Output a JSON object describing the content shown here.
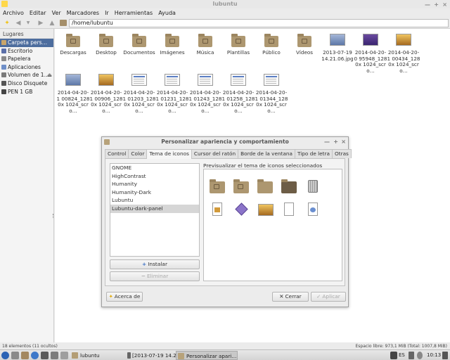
{
  "window": {
    "title": "lubuntu",
    "controls": [
      "—",
      "+",
      "×"
    ]
  },
  "menu": [
    "Archivo",
    "Editar",
    "Ver",
    "Marcadores",
    "Ir",
    "Herramientas",
    "Ayuda"
  ],
  "location": {
    "path": "/home/lubuntu"
  },
  "sidebar": {
    "header": "Lugares",
    "items": [
      {
        "label": "Carpeta pers…",
        "icon": "home-icon",
        "color": "#c9a66b"
      },
      {
        "label": "Escritorio",
        "icon": "desktop-icon",
        "color": "#5b6fa8"
      },
      {
        "label": "Papelera",
        "icon": "trash-icon",
        "color": "#8a8a8a"
      },
      {
        "label": "Aplicaciones",
        "icon": "applications-icon",
        "color": "#6f8fc8"
      },
      {
        "label": "Volumen de 1…",
        "icon": "drive-icon",
        "color": "#7a7a7a"
      },
      {
        "label": "Disco Disquete",
        "icon": "floppy-icon",
        "color": "#555555"
      },
      {
        "label": "PEN 1 GB",
        "icon": "usb-icon",
        "color": "#444444"
      }
    ]
  },
  "files": [
    {
      "name": "Descargas",
      "kind": "folder"
    },
    {
      "name": "Desktop",
      "kind": "folder"
    },
    {
      "name": "Documentos",
      "kind": "folder"
    },
    {
      "name": "Imágenes",
      "kind": "folder"
    },
    {
      "name": "Música",
      "kind": "folder"
    },
    {
      "name": "Plantillas",
      "kind": "folder"
    },
    {
      "name": "Público",
      "kind": "folder"
    },
    {
      "name": "Vídeos",
      "kind": "folder"
    },
    {
      "name": "2013-07-19 14.21.06.jpg",
      "kind": "blue"
    },
    {
      "name": "2014-04-20-0 95948_1280x 1024_scro…",
      "kind": "purple"
    },
    {
      "name": "2014-04-20-1 00434_1280x 1024_scro…",
      "kind": "tree"
    },
    {
      "name": "2014-04-20-1 00824_1280x 1024_scro…",
      "kind": "blue"
    },
    {
      "name": "2014-04-20-1 00906_1280x 1024_scro…",
      "kind": "tree"
    },
    {
      "name": "2014-04-20-1 01203_1280x 1024_scro…",
      "kind": "white"
    },
    {
      "name": "2014-04-20-1 01231_1280x 1024_scro…",
      "kind": "white"
    },
    {
      "name": "2014-04-20-1 01243_1280x 1024_scro…",
      "kind": "white"
    },
    {
      "name": "2014-04-20-1 01258_1280x 1024_scro…",
      "kind": "white"
    },
    {
      "name": "2014-04-20-1 01344_1280x 1024_scro…",
      "kind": "white"
    }
  ],
  "dialog": {
    "title": "Personalizar apariencia y comportamiento",
    "controls": [
      "—",
      "+",
      "×"
    ],
    "tabs": [
      "Control",
      "Color",
      "Tema de iconos",
      "Cursor del ratón",
      "Borde de la ventana",
      "Tipo de letra",
      "Otras"
    ],
    "themes": [
      "GNOME",
      "HighContrast",
      "Humanity",
      "Humanity-Dark",
      "Lubuntu",
      "Lubuntu-dark-panel"
    ],
    "install_label": "Instalar",
    "remove_label": "Eliminar",
    "preview_label": "Previsualizar el tema de iconos seleccionados",
    "about_label": "Acerca de",
    "close_label": "Cerrar",
    "apply_label": "Aplicar"
  },
  "status": {
    "left": "18 elementos (11 ocultos)",
    "right": "Espacio libre: 973,1 MiB (Total: 1007,8 MiB)"
  },
  "taskbar": {
    "tasks": [
      "lubuntu",
      "[2013-07-19 14.2…",
      "Personalizar apari…"
    ],
    "keyboard": "ES",
    "clock": "10:13"
  }
}
